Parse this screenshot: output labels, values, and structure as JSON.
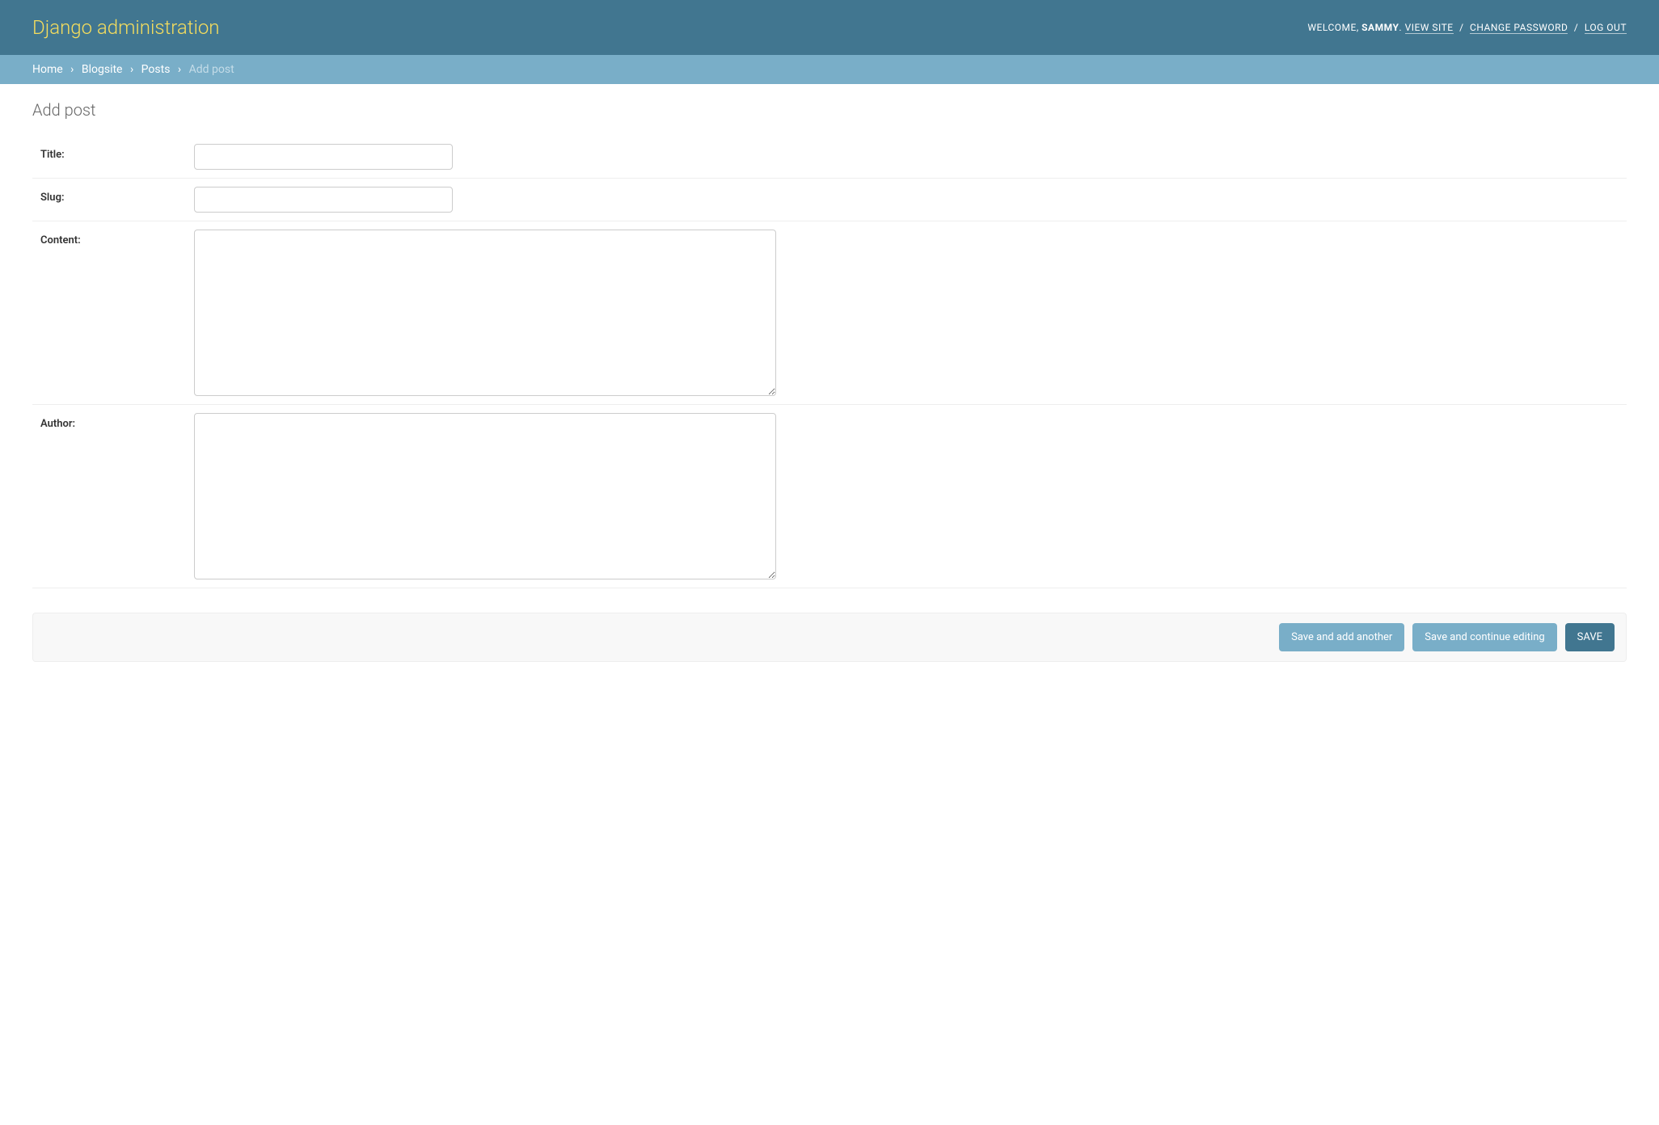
{
  "header": {
    "branding": "Django administration",
    "welcome": "WELCOME,",
    "username": "SAMMY",
    "view_site": "VIEW SITE",
    "change_password": "CHANGE PASSWORD",
    "log_out": "LOG OUT"
  },
  "breadcrumbs": {
    "home": "Home",
    "app": "Blogsite",
    "model": "Posts",
    "current": "Add post"
  },
  "page": {
    "title": "Add post"
  },
  "form": {
    "title_label": "Title:",
    "title_value": "",
    "slug_label": "Slug:",
    "slug_value": "",
    "content_label": "Content:",
    "content_value": "",
    "author_label": "Author:",
    "author_value": ""
  },
  "buttons": {
    "save_add_another": "Save and add another",
    "save_continue": "Save and continue editing",
    "save": "SAVE"
  }
}
